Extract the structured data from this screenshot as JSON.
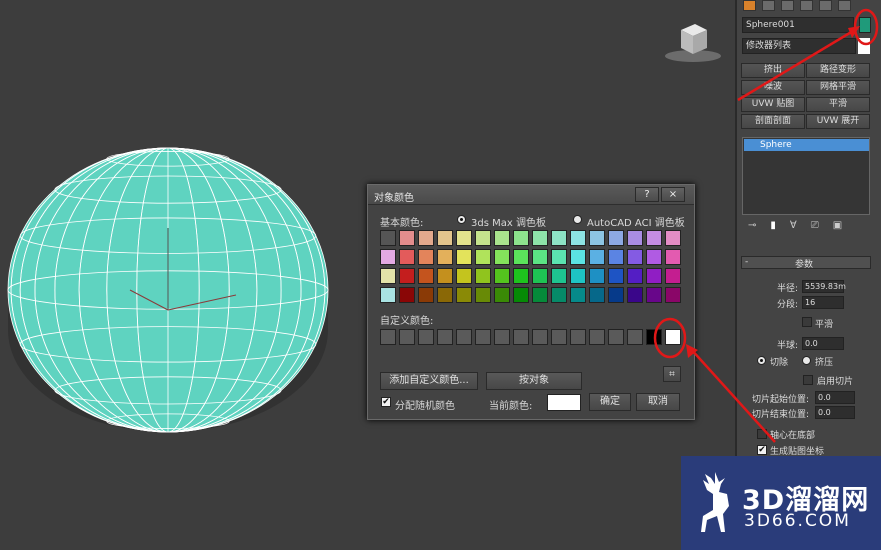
{
  "dialog": {
    "title": "对象颜色",
    "help_label": "?",
    "close_label": "×",
    "basic_colors_label": "基本颜色:",
    "palette_max_label": "3ds Max 调色板",
    "palette_aci_label": "AutoCAD ACI 调色板",
    "custom_colors_label": "自定义颜色:",
    "add_custom_label": "添加自定义颜色...",
    "by_object_label": "按对象",
    "assign_random_label": "分配随机颜色",
    "current_color_label": "当前颜色:",
    "ok_label": "确定",
    "cancel_label": "取消",
    "current_color": "#ffffff",
    "palette_rows": [
      [
        "#555555",
        "#e38d8d",
        "#e3a98d",
        "#e3c58d",
        "#e3e38d",
        "#c5e38d",
        "#a9e38d",
        "#8de38d",
        "#8de3a9",
        "#8de3c5",
        "#8de3e3",
        "#8dc5e3",
        "#8da9e3",
        "#a98de3",
        "#c58de3",
        "#e38dc5"
      ],
      [
        "#e3a9e3",
        "#e35b5b",
        "#e3845b",
        "#e3b05b",
        "#e3e35b",
        "#b0e35b",
        "#84e35b",
        "#5be35b",
        "#5be384",
        "#5be3b0",
        "#5be3e3",
        "#5bb0e3",
        "#5b84e3",
        "#845be3",
        "#b05be3",
        "#e35bb0"
      ],
      [
        "#e3e3a9",
        "#c41e1e",
        "#c4541e",
        "#c4901e",
        "#c4c41e",
        "#90c41e",
        "#54c41e",
        "#1ec41e",
        "#1ec454",
        "#1ec490",
        "#1ec4c4",
        "#1e90c4",
        "#1e54c4",
        "#541ec4",
        "#901ec4",
        "#c41e90"
      ],
      [
        "#a9e3e3",
        "#8a0606",
        "#8a3a06",
        "#8a6806",
        "#8a8a06",
        "#688a06",
        "#3a8a06",
        "#068a06",
        "#068a3a",
        "#068a68",
        "#068a8a",
        "#06688a",
        "#063a8a",
        "#3a068a",
        "#68068a",
        "#8a0668"
      ]
    ],
    "custom_row": [
      "#5a5a5a",
      "#5a5a5a",
      "#5a5a5a",
      "#5a5a5a",
      "#5a5a5a",
      "#5a5a5a",
      "#5a5a5a",
      "#5a5a5a",
      "#5a5a5a",
      "#5a5a5a",
      "#5a5a5a",
      "#5a5a5a",
      "#5a5a5a",
      "#5a5a5a",
      "#000000",
      "#ffffff"
    ]
  },
  "panel": {
    "object_name": "Sphere001",
    "object_color": "#1f9a7a",
    "modifier_list": "修改器列表",
    "buttons": [
      "挤出",
      "路径变形",
      "噪波",
      "网格平滑",
      "UVW 贴图",
      "平滑",
      "剖面剖面",
      "UVW 展开"
    ],
    "stack_item": "Sphere",
    "rollout_title": "参数",
    "radius_label": "半径:",
    "radius_value": "5539.83m",
    "segments_label": "分段:",
    "segments_value": "16",
    "smooth_label": "平滑",
    "hemisphere_label": "半球:",
    "hemisphere_value": "0.0",
    "chop_label": "切除",
    "squash_label": "挤压",
    "enable_slice_label": "启用切片",
    "slice_from_label": "切片起始位置:",
    "slice_from_value": "0.0",
    "slice_to_label": "切片结束位置:",
    "slice_to_value": "0.0",
    "base_pivot_label": "轴心在底部",
    "gen_map_label": "生成贴图坐标"
  },
  "watermark": {
    "main": "3D溜溜网",
    "sub": "3D66.COM"
  },
  "colors": {
    "sphere": "#5fd3c0",
    "annotation": "#e01818"
  }
}
